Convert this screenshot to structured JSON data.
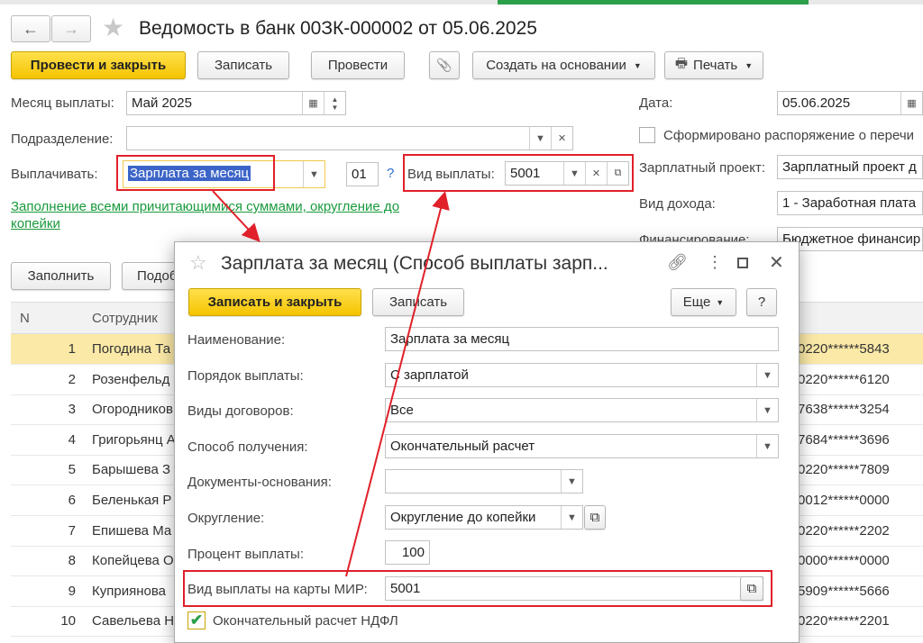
{
  "window": {
    "title": "Ведомость в банк 00ЗК-000002 от 05.06.2025",
    "back_icon": "←",
    "forward_icon": "→",
    "star_icon": "★"
  },
  "toolbar": {
    "post_close": "Провести и закрыть",
    "save": "Записать",
    "post": "Провести",
    "attach_icon": "📎",
    "create_based": "Создать на основании",
    "print_icon": "🖶",
    "print": "Печать"
  },
  "form": {
    "month_label": "Месяц выплаты:",
    "month_value": "Май 2025",
    "dept_label": "Подразделение:",
    "dept_value": "",
    "pay_label": "Выплачивать:",
    "pay_value": "Зарплата за месяц",
    "code_value": "01",
    "help_mark": "?",
    "pay_type_label": "Вид выплаты:",
    "pay_type_value": "5001",
    "fill_link": "Заполнение всеми причитающимися суммами, округление до копейки",
    "date_label": "Дата:",
    "date_value": "05.06.2025",
    "order_check": "Сформировано распоряжение о перечи",
    "project_label": "Зарплатный проект:",
    "project_value": "Зарплатный проект д",
    "income_label": "Вид дохода:",
    "income_value": "1 - Заработная плата",
    "finance_label": "Финансирование:",
    "finance_value": "Бюджетное финансир"
  },
  "list_toolbar": {
    "fill": "Заполнить",
    "select": "Подоб"
  },
  "table": {
    "headers": [
      "N",
      "Сотрудник"
    ],
    "rows": [
      {
        "n": "1",
        "name": "Погодина Та",
        "account": "0220******5843"
      },
      {
        "n": "2",
        "name": "Розенфельд",
        "account": "0220******6120"
      },
      {
        "n": "3",
        "name": "Огородников",
        "account": "7638******3254"
      },
      {
        "n": "4",
        "name": "Григорьянц А",
        "account": "7684******3696"
      },
      {
        "n": "5",
        "name": "Барышева З",
        "account": "0220******7809"
      },
      {
        "n": "6",
        "name": "Беленькая Р",
        "account": "0012******0000"
      },
      {
        "n": "7",
        "name": "Епишева Ма",
        "account": "0220******2202"
      },
      {
        "n": "8",
        "name": "Копейцева О",
        "account": "0000******0000"
      },
      {
        "n": "9",
        "name": "Куприянова",
        "account": "5909******5666"
      },
      {
        "n": "10",
        "name": "Савельева Н",
        "account": "0220******2201"
      }
    ],
    "row9_mark": "?"
  },
  "dialog": {
    "title": "Зарплата за месяц (Способ выплаты зарп...",
    "save_close": "Записать и закрыть",
    "save": "Записать",
    "more": "Еще",
    "help": "?",
    "name_label": "Наименование:",
    "name_value": "Зарплата за месяц",
    "order_label": "Порядок выплаты:",
    "order_value": "С зарплатой",
    "contracts_label": "Виды договоров:",
    "contracts_value": "Все",
    "receive_label": "Способ получения:",
    "receive_value": "Окончательный расчет",
    "docs_label": "Документы-основания:",
    "docs_value": "",
    "rounding_label": "Округление:",
    "rounding_value": "Округление до копейки",
    "percent_label": "Процент выплаты:",
    "percent_value": "100",
    "mir_label": "Вид выплаты на карты МИР:",
    "mir_value": "5001",
    "ndfl_check": "Окончательный расчет НДФЛ",
    "ndfl_checked": true
  },
  "colors": {
    "accent_yellow": "#f5c400",
    "highlight_red": "#e0202a",
    "link_green": "#1a9a3c",
    "row_selected": "#fbe9a7"
  }
}
